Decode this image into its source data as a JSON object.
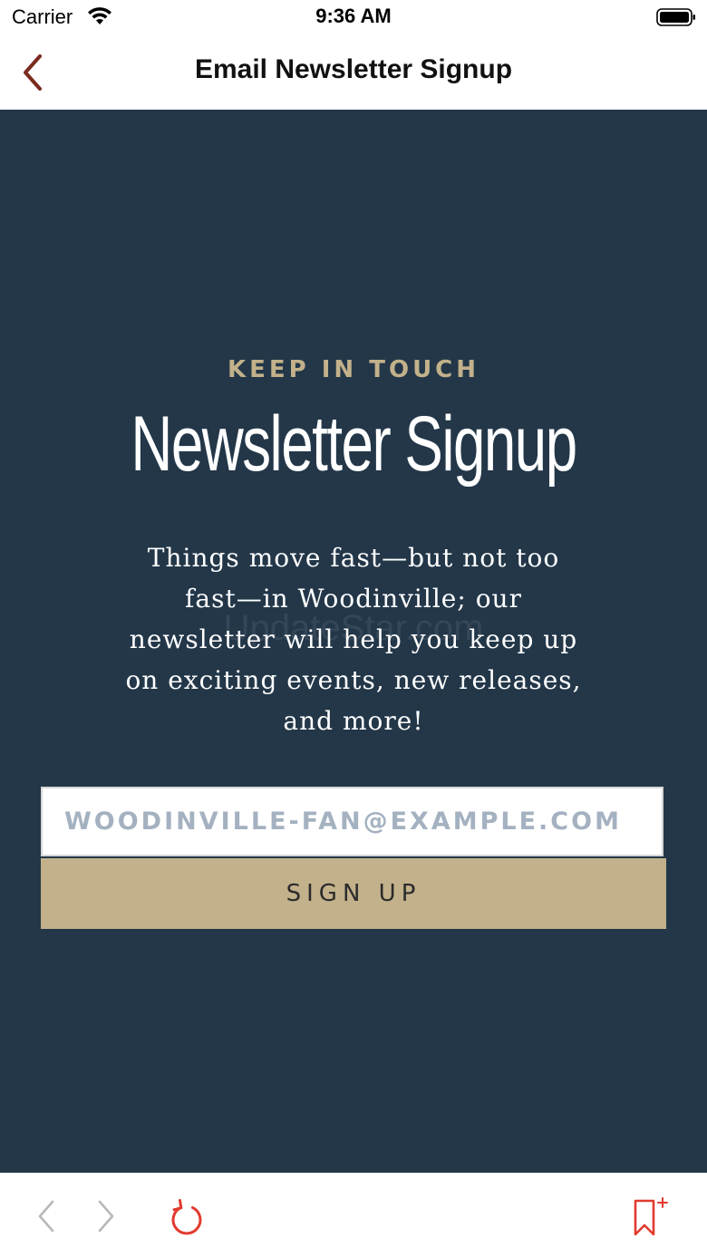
{
  "status_bar": {
    "carrier": "Carrier",
    "time": "9:36 AM"
  },
  "nav": {
    "title": "Email Newsletter Signup",
    "back_icon": "chevron-left-icon",
    "accent_color": "#7a2a1f"
  },
  "main": {
    "eyebrow": "KEEP IN TOUCH",
    "headline": "Newsletter Signup",
    "body": "Things move fast—but not too fast—in Woodinville; our newsletter will help you keep up on exciting events, new releases, and more!",
    "watermark": "UpdateStar.com",
    "email_placeholder": "woodinville-fan@example.com",
    "email_value": "",
    "signup_label": "SIGN UP",
    "background_color": "#233749",
    "accent_color": "#c2b18a"
  },
  "toolbar": {
    "back_icon": "chevron-left-icon",
    "forward_icon": "chevron-right-icon",
    "reload_icon": "reload-icon",
    "bookmark_icon": "bookmark-add-icon",
    "active_color": "#e23a2e",
    "disabled_color": "#b8b8b8"
  }
}
